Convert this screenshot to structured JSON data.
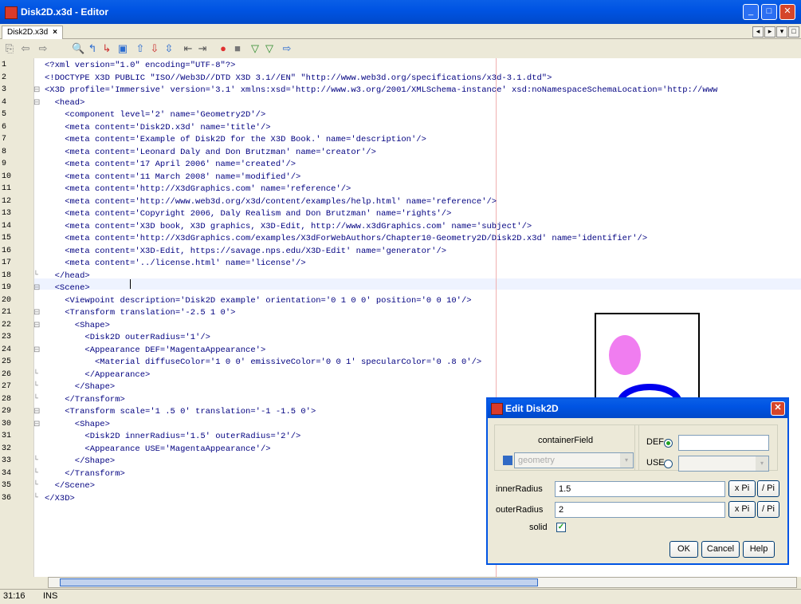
{
  "window": {
    "title": "Disk2D.x3d - Editor",
    "min": "_",
    "max": "□",
    "close": "✕"
  },
  "tab": {
    "label": "Disk2D.x3d",
    "close": "×"
  },
  "tab_nav": {
    "left": "◂",
    "right": "▸",
    "menu": "▾",
    "restore": "□"
  },
  "toolbar_icons": [
    "doc-icon",
    "back-icon",
    "forward-icon",
    "find-icon",
    "find-prev-icon",
    "find-next-icon",
    "toggle-highlight-icon",
    "prev-bookmark-icon",
    "next-bookmark-icon",
    "toggle-bookmark-icon",
    "shift-left-icon",
    "shift-right-icon",
    "record-macro-icon",
    "stop-macro-icon",
    "prev-error-icon",
    "next-error-icon",
    "insert-icon"
  ],
  "toolbar_glyphs": [
    "⎘",
    "⇦",
    "⇨",
    "🔍",
    "↰",
    "↳",
    "▣",
    "⇧",
    "⇩",
    "⇳",
    "⇤",
    "⇥",
    "●",
    "■",
    "▽",
    "▽",
    "⇨"
  ],
  "line_numbers": [
    "1",
    "2",
    "3",
    "4",
    "5",
    "6",
    "7",
    "8",
    "9",
    "10",
    "11",
    "12",
    "13",
    "14",
    "15",
    "16",
    "17",
    "18",
    "19",
    "20",
    "21",
    "22",
    "23",
    "24",
    "25",
    "26",
    "27",
    "28",
    "29",
    "30",
    "31",
    "32",
    "33",
    "34",
    "35",
    "36"
  ],
  "folds": [
    "",
    "",
    "⊟",
    "⊟",
    "",
    "",
    "",
    "",
    "",
    "",
    "",
    "",
    "",
    "",
    "",
    "",
    "",
    "└",
    "⊟",
    "",
    "⊟",
    "⊟",
    "",
    "⊟",
    "",
    "└",
    "└",
    "└",
    "⊟",
    "⊟",
    "",
    "",
    "└",
    "└",
    "└",
    "└"
  ],
  "code": [
    "<?xml version=\"1.0\" encoding=\"UTF-8\"?>",
    "<!DOCTYPE X3D PUBLIC \"ISO//Web3D//DTD X3D 3.1//EN\" \"http://www.web3d.org/specifications/x3d-3.1.dtd\">",
    "<X3D profile='Immersive' version='3.1' xmlns:xsd='http://www.w3.org/2001/XMLSchema-instance' xsd:noNamespaceSchemaLocation='http://www",
    "  <head>",
    "    <component level='2' name='Geometry2D'/>",
    "    <meta content='Disk2D.x3d' name='title'/>",
    "    <meta content='Example of Disk2D for the X3D Book.' name='description'/>",
    "    <meta content='Leonard Daly and Don Brutzman' name='creator'/>",
    "    <meta content='17 April 2006' name='created'/>",
    "    <meta content='11 March 2008' name='modified'/>",
    "    <meta content='http://X3dGraphics.com' name='reference'/>",
    "    <meta content='http://www.web3d.org/x3d/content/examples/help.html' name='reference'/>",
    "    <meta content='Copyright 2006, Daly Realism and Don Brutzman' name='rights'/>",
    "    <meta content='X3D book, X3D graphics, X3D-Edit, http://www.x3dGraphics.com' name='subject'/>",
    "    <meta content='http://X3dGraphics.com/examples/X3dForWebAuthors/Chapter10-Geometry2D/Disk2D.x3d' name='identifier'/>",
    "    <meta content='X3D-Edit, https://savage.nps.edu/X3D-Edit' name='generator'/>",
    "    <meta content='../license.html' name='license'/>",
    "  </head>",
    "  <Scene>",
    "    <Viewpoint description='Disk2D example' orientation='0 1 0 0' position='0 0 10'/>",
    "    <Transform translation='-2.5 1 0'>",
    "      <Shape>",
    "        <Disk2D outerRadius='1'/>",
    "        <Appearance DEF='MagentaAppearance'>",
    "          <Material diffuseColor='1 0 0' emissiveColor='0 0 1' specularColor='0 .8 0'/>",
    "        </Appearance>",
    "      </Shape>",
    "    </Transform>",
    "    <Transform scale='1 .5 0' translation='-1 -1.5 0'>",
    "      <Shape>",
    "        <Disk2D innerRadius='1.5' outerRadius='2'/>",
    "        <Appearance USE='MagentaAppearance'/>",
    "      </Shape>",
    "    </Transform>",
    "  </Scene>",
    "</X3D>"
  ],
  "status": {
    "position": "31:16",
    "mode": "INS"
  },
  "preview_colors": {
    "disk": "#F07DF0",
    "ring": "#0000EE"
  },
  "dialog": {
    "title": "Edit Disk2D",
    "close": "✕",
    "container_field_label": "containerField",
    "container_field_value": "geometry",
    "def_label": "DEF",
    "use_label": "USE",
    "def_value": "",
    "use_value": "",
    "inner_radius_label": "innerRadius",
    "inner_radius_value": "1.5",
    "outer_radius_label": "outerRadius",
    "outer_radius_value": "2",
    "solid_label": "solid",
    "solid_check": "✓",
    "xpi_label": "x Pi",
    "divpi_label": "/ Pi",
    "ok_label": "OK",
    "cancel_label": "Cancel",
    "help_label": "Help",
    "arrow": "▾"
  }
}
